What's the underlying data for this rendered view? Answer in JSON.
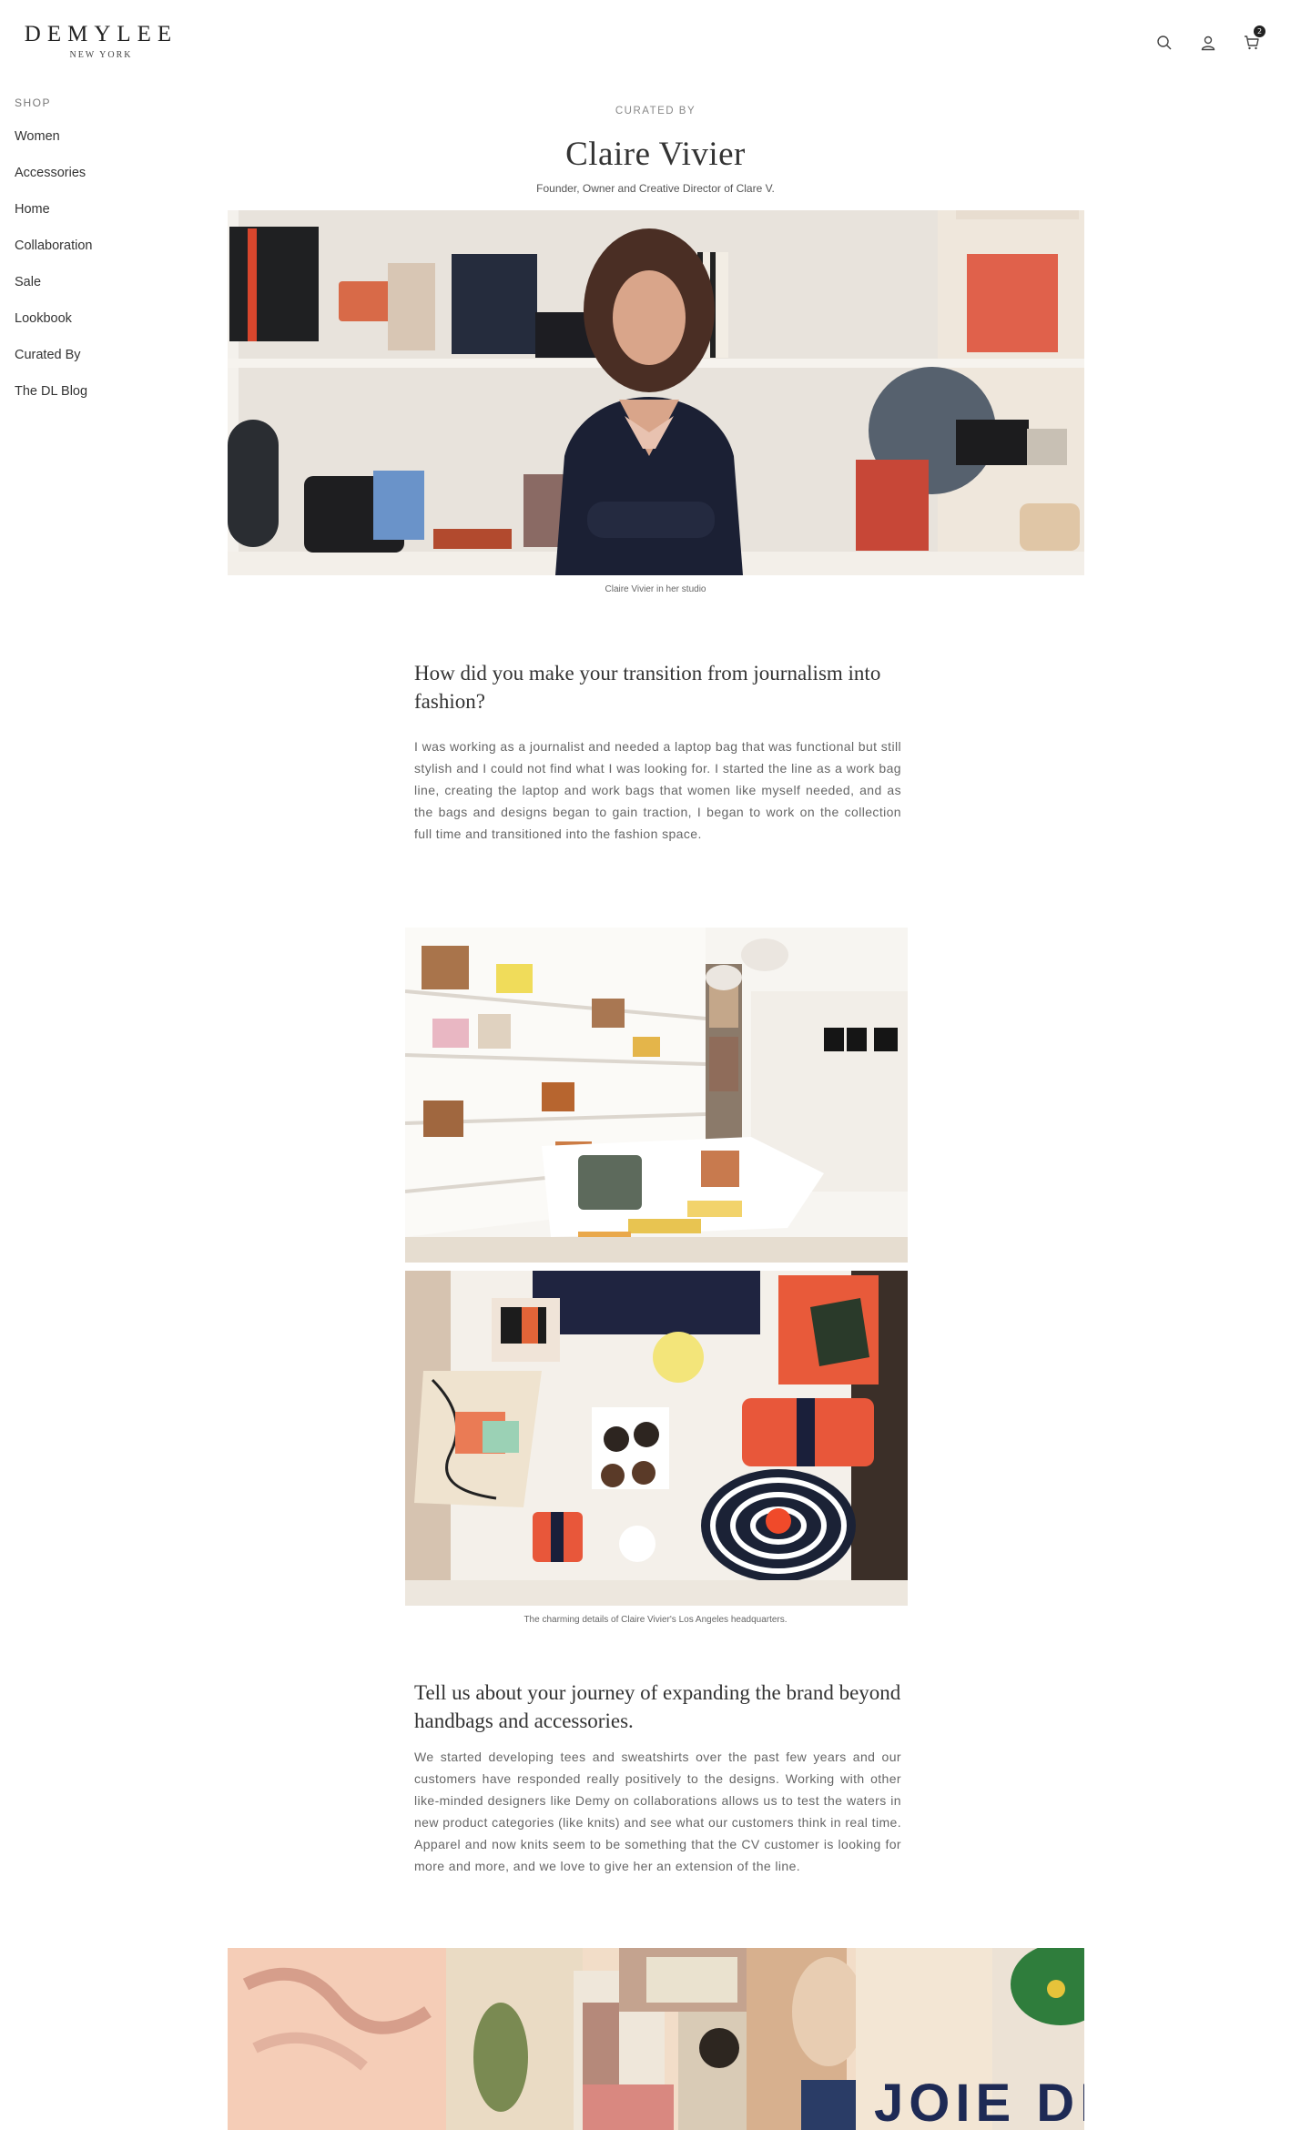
{
  "brand": {
    "name": "DEMYLEE",
    "location": "NEW YORK"
  },
  "header": {
    "cart_count": "2"
  },
  "sidebar": {
    "heading": "SHOP",
    "items": [
      {
        "label": "Women"
      },
      {
        "label": "Accessories"
      },
      {
        "label": "Home"
      },
      {
        "label": "Collaboration"
      },
      {
        "label": "Sale"
      },
      {
        "label": "Lookbook"
      },
      {
        "label": "Curated By"
      },
      {
        "label": "The DL Blog"
      }
    ]
  },
  "article": {
    "eyebrow": "CURATED BY",
    "title": "Claire Vivier",
    "subtitle": "Founder, Owner and Creative Director of Clare V.",
    "hero_caption": "Claire Vivier in her studio",
    "q1": {
      "question": "How did you make your transition from journalism into fashion?",
      "answer": "I was working as a journalist and needed a laptop bag that was functional but still stylish and I could not find what I was looking for. I started the line as a work bag line, creating the laptop and work bags that women like myself needed, and as the bags and designs began to gain traction, I began to work on the collection full time and transitioned into the fashion space."
    },
    "gallery_caption": "The charming details of Claire Vivier's Los Angeles headquarters.",
    "q2": {
      "question": "Tell us about your journey of expanding the brand beyond handbags and accessories.",
      "answer": "We started developing tees and sweatshirts over the past few years and our customers have responded really positively to the designs. Working with other like-minded designers like Demy on collaborations allows us to test the waters in new product categories (like knits) and see what our customers think in real time. Apparel and now knits seem to be something that the CV customer is looking for more and more, and we love to give her an extension of the line."
    },
    "moodboard_text": "JOIE DE"
  }
}
